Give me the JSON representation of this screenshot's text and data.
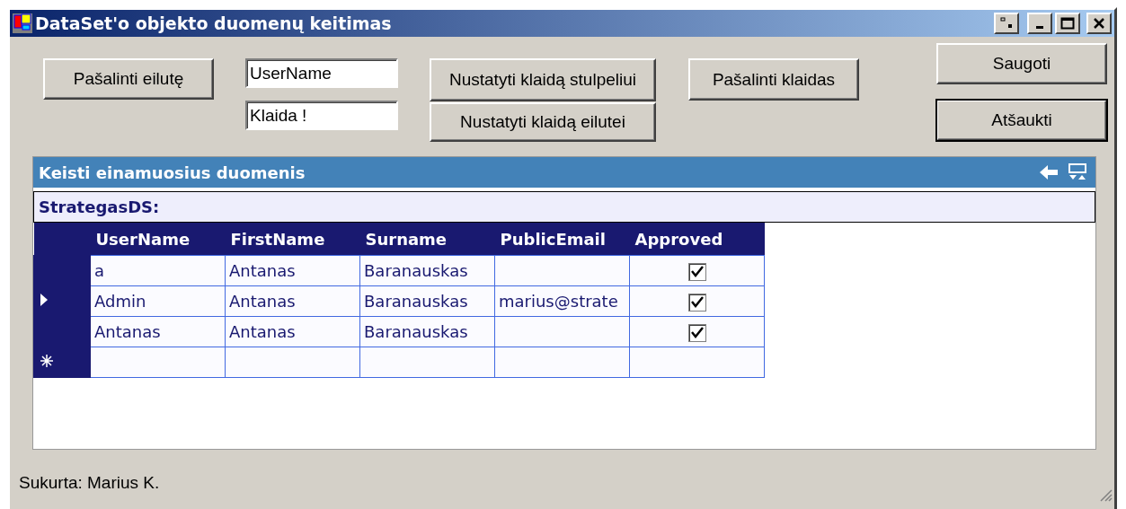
{
  "window": {
    "title": "DataSet'o objekto duomenų keitimas"
  },
  "toolbar": {
    "remove_row_button": "Pašalinti eilutę",
    "column_field": {
      "value": "UserName"
    },
    "error_field": {
      "value": "Klaida !"
    },
    "set_column_error_button": "Nustatyti klaidą stulpeliui",
    "set_row_error_button": "Nustatyti klaidą eilutei",
    "clear_errors_button": "Pašalinti klaidas"
  },
  "dialog_buttons": [
    {
      "label": "Saugoti",
      "default": false
    },
    {
      "label": "Atšaukti",
      "default": true
    }
  ],
  "grid": {
    "caption": "Keisti einamuosius duomenis",
    "dataset": "StrategasDS:",
    "columns": [
      "UserName",
      "FirstName",
      "Surname",
      "PublicEmail",
      "Approved"
    ],
    "rows": [
      {
        "kind": "data",
        "current": false,
        "cells": [
          "a",
          "Antanas",
          "Baranauskas",
          ""
        ],
        "approved": true
      },
      {
        "kind": "data",
        "current": true,
        "cells": [
          "Admin",
          "Antanas",
          "Baranauskas",
          "marius@strate"
        ],
        "approved": true
      },
      {
        "kind": "data",
        "current": false,
        "cells": [
          "Antanas",
          "Antanas",
          "Baranauskas",
          ""
        ],
        "approved": true
      },
      {
        "kind": "new"
      }
    ]
  },
  "status_bar": {
    "text": "Sukurta: Marius K."
  }
}
